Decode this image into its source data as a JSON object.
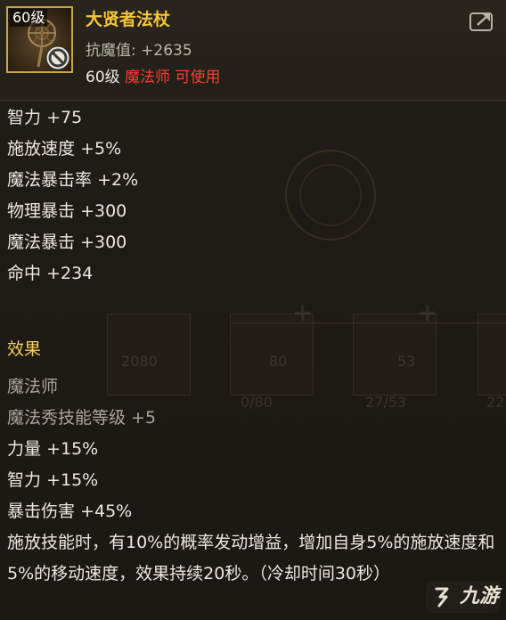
{
  "item": {
    "level_tag": "60级",
    "name": "大贤者法杖",
    "resist_label": "抗魔值:",
    "resist_value": "+2635",
    "req_level": "60级",
    "req_class": "魔法师",
    "req_suffix": "可使用"
  },
  "stats": [
    {
      "label": "智力",
      "value": "+75"
    },
    {
      "label": "施放速度",
      "value": "+5%"
    },
    {
      "label": "魔法暴击率",
      "value": "+2%"
    },
    {
      "label": "物理暴击",
      "value": "+300"
    },
    {
      "label": "魔法暴击",
      "value": "+300"
    },
    {
      "label": "命中",
      "value": "+234"
    }
  ],
  "effects": {
    "title": "效果",
    "class_line": "魔法师",
    "skill_line": "魔法秀技能等级 +5",
    "lines": [
      {
        "label": "力量",
        "value": "+15%"
      },
      {
        "label": "智力",
        "value": "+15%"
      },
      {
        "label": "暴击伤害",
        "value": "+45%"
      }
    ],
    "description": "施放技能时，有10%的概率发动增益，增加自身5%的施放速度和5%的移动速度，效果持续20秒。（冷却时间30秒）"
  },
  "background": {
    "slot_values": [
      "2080",
      "80",
      "53",
      "22"
    ],
    "slot_sub": [
      "0/80",
      "27/53",
      "22"
    ]
  },
  "watermark": {
    "text": "九游"
  },
  "icons": [
    "staff-icon",
    "forbidden-icon",
    "share-icon",
    "jiuyou-logo-icon"
  ],
  "colors": {
    "name": "#f5c53b",
    "class_restricted": "#ff3b30",
    "section": "#f2cf5a",
    "frame": "#c9a646"
  }
}
